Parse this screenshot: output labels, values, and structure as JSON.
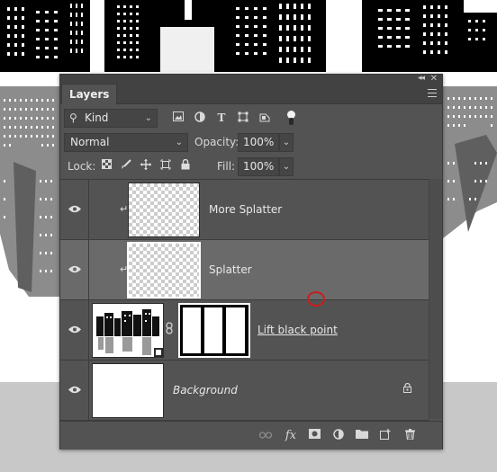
{
  "panel": {
    "tab_label": "Layers",
    "collapse_glyph": "◂◂",
    "close_glyph": "✕"
  },
  "filter": {
    "kind_label": "Kind",
    "icons": [
      "image-filter-icon",
      "adjustment-filter-icon",
      "type-filter-icon",
      "shape-filter-icon",
      "smart-object-filter-icon",
      "filter-toggle-icon"
    ]
  },
  "blend": {
    "mode": "Normal",
    "opacity_label": "Opacity:",
    "opacity_value": "100%"
  },
  "lock": {
    "label": "Lock:",
    "fill_label": "Fill:",
    "fill_value": "100%",
    "icons": [
      "lock-transparent-pixels-icon",
      "lock-image-pixels-icon",
      "lock-position-icon",
      "lock-artboard-icon",
      "lock-all-icon"
    ]
  },
  "layers": [
    {
      "name": "More Splatter",
      "visible": true,
      "clipped": true,
      "selected": false
    },
    {
      "name": "Splatter",
      "visible": true,
      "clipped": true,
      "selected": true
    },
    {
      "name": "Lift black point",
      "visible": true,
      "clipped": false,
      "selected": false
    },
    {
      "name": "Background",
      "visible": true,
      "clipped": false,
      "selected": false,
      "locked": true
    }
  ],
  "bottom_bar": {
    "fx_label": "fx",
    "icons": [
      "link-layers-icon",
      "fx-icon",
      "add-mask-icon",
      "adjustment-layer-icon",
      "new-group-icon",
      "new-layer-icon",
      "trash-icon"
    ]
  },
  "colors": {
    "panel_bg": "#535353",
    "selected_row": "#6a6a6a",
    "cursor_ring": "#c81e1e"
  }
}
